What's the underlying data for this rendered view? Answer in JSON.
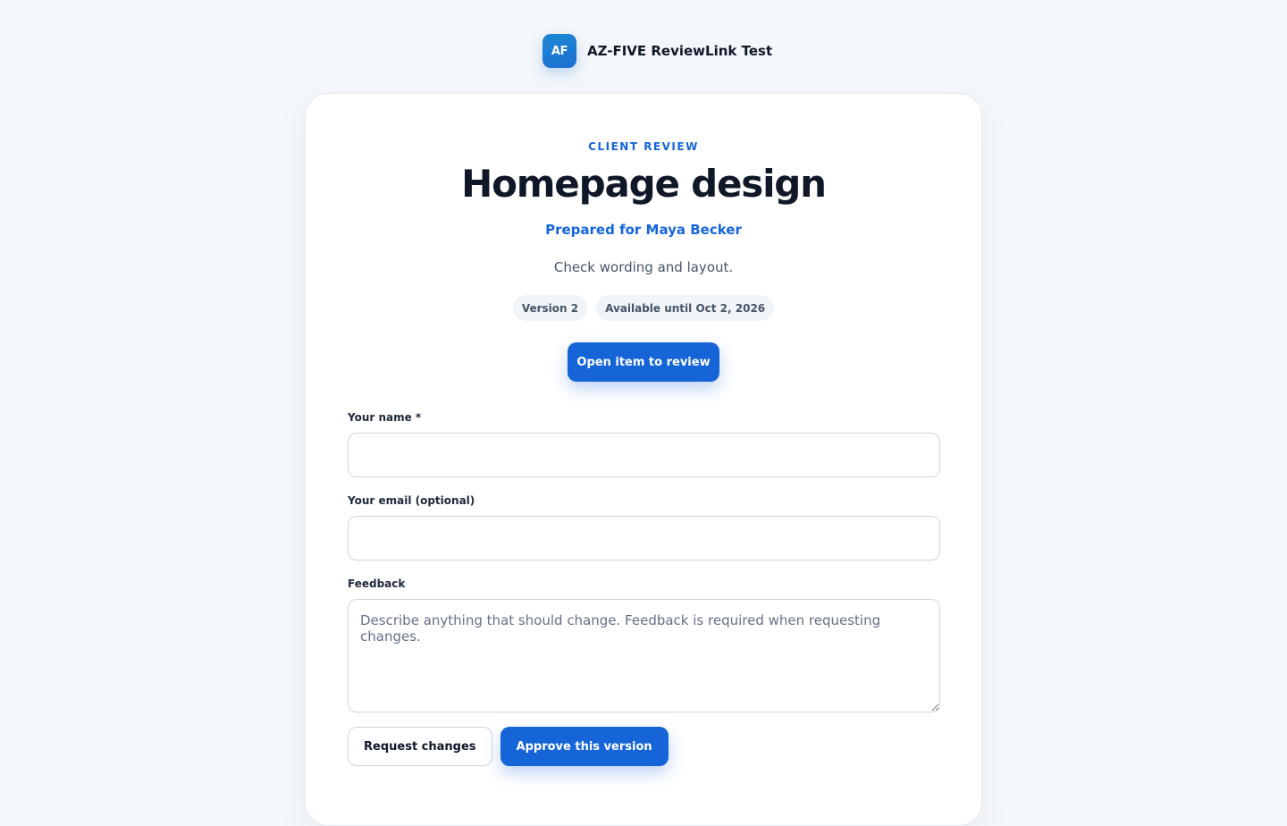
{
  "brand": {
    "initials": "AF",
    "name": "AZ-FIVE ReviewLink Test",
    "accent_color": "#1565d8"
  },
  "review": {
    "eyebrow": "CLIENT REVIEW",
    "title": "Homepage design",
    "prepared_for": "Prepared for Maya Becker",
    "description": "Check wording and layout.",
    "version_badge": "Version 2",
    "availability_badge": "Available until Oct 2, 2026",
    "open_button_label": "Open item to review"
  },
  "form": {
    "name_label": "Your name *",
    "name_value": "",
    "email_label": "Your email (optional)",
    "email_value": "",
    "feedback_label": "Feedback",
    "feedback_placeholder": "Describe anything that should change. Feedback is required when requesting changes.",
    "feedback_value": ""
  },
  "actions": {
    "request_changes_label": "Request changes",
    "approve_label": "Approve this version"
  }
}
